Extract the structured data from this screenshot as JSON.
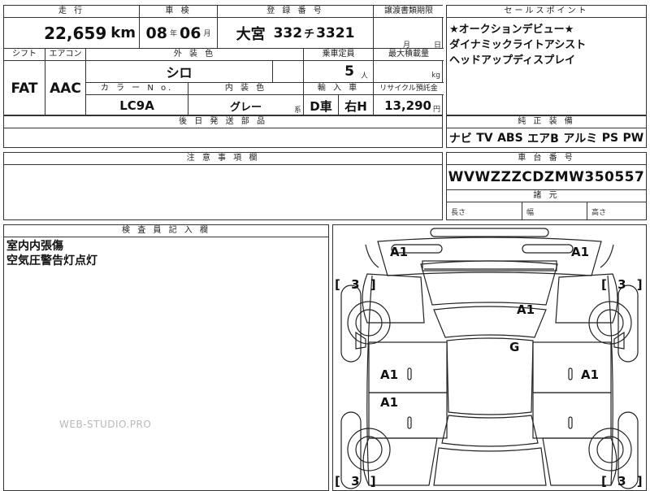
{
  "header_labels": {
    "mileage": "走 行",
    "inspection": "車 検",
    "registration": "登 録 番 号",
    "transfer_deadline": "譲渡書類期限",
    "selling_points": "セールスポイント",
    "shift": "シフト",
    "aircon": "エアコン",
    "exterior_color": "外 装 色",
    "capacity": "乗車定員",
    "max_load": "最大積載量",
    "color_no": "カ ラ ー N o.",
    "interior_color": "内 装 色",
    "import_car": "輸 入 車",
    "recycle_fee": "リサイクル預託金",
    "later_delivery": "後 日 発 送 部 品",
    "standard_equipment": "純 正 装 備",
    "notes": "注 意 事 項 欄",
    "chassis_number": "車 台 番 号",
    "dimensions": "諸 元",
    "inspector_notes": "検 査 員 記 入 欄"
  },
  "vehicle": {
    "mileage": "22,659",
    "mileage_unit": "km",
    "inspection_year": "08",
    "year_unit": "年",
    "inspection_month": "06",
    "month_unit": "月",
    "plate_region": "大宮",
    "plate_class": "332",
    "plate_kana": "チ",
    "plate_number": "3321",
    "deadline_month_unit": "月",
    "deadline_day_unit": "日",
    "shift": "FAT",
    "aircon": "AAC",
    "exterior_color": "シロ",
    "capacity": "5",
    "capacity_unit": "人",
    "max_load_unit": "kg",
    "color_no": "LC9A",
    "interior_color": "グレー",
    "interior_suffix": "系",
    "import_type": "D車",
    "steering": "右H",
    "recycle_fee": "13,290",
    "recycle_unit": "円",
    "chassis_number": "WVWZZZCDZMW350557"
  },
  "selling_points": [
    "★オークションデビュー★",
    "ダイナミックライトアシスト",
    "ヘッドアップディスプレイ"
  ],
  "equipment": [
    "ナビ",
    "TV",
    "ABS",
    "エアB",
    "アルミ",
    "PS",
    "PW"
  ],
  "dimensions": {
    "length": "長さ",
    "width": "幅",
    "height": "高さ"
  },
  "inspector_notes": [
    "室内内張傷",
    "空気圧警告灯点灯"
  ],
  "diagram": {
    "marks": {
      "front_left_corner": "A1",
      "front_right_corner": "A1",
      "roof_right": "A1",
      "glass": "G",
      "left_front_door": "A1",
      "right_front_door": "A1",
      "left_rear_door": "A1"
    },
    "tire_brackets": {
      "front_left": "[ 3 ]",
      "front_right": "[ 3 ]",
      "rear_left": "[ 3 ]",
      "rear_right": "[ 3 ]"
    }
  },
  "watermark": "WEB-STUDIO.PRO"
}
